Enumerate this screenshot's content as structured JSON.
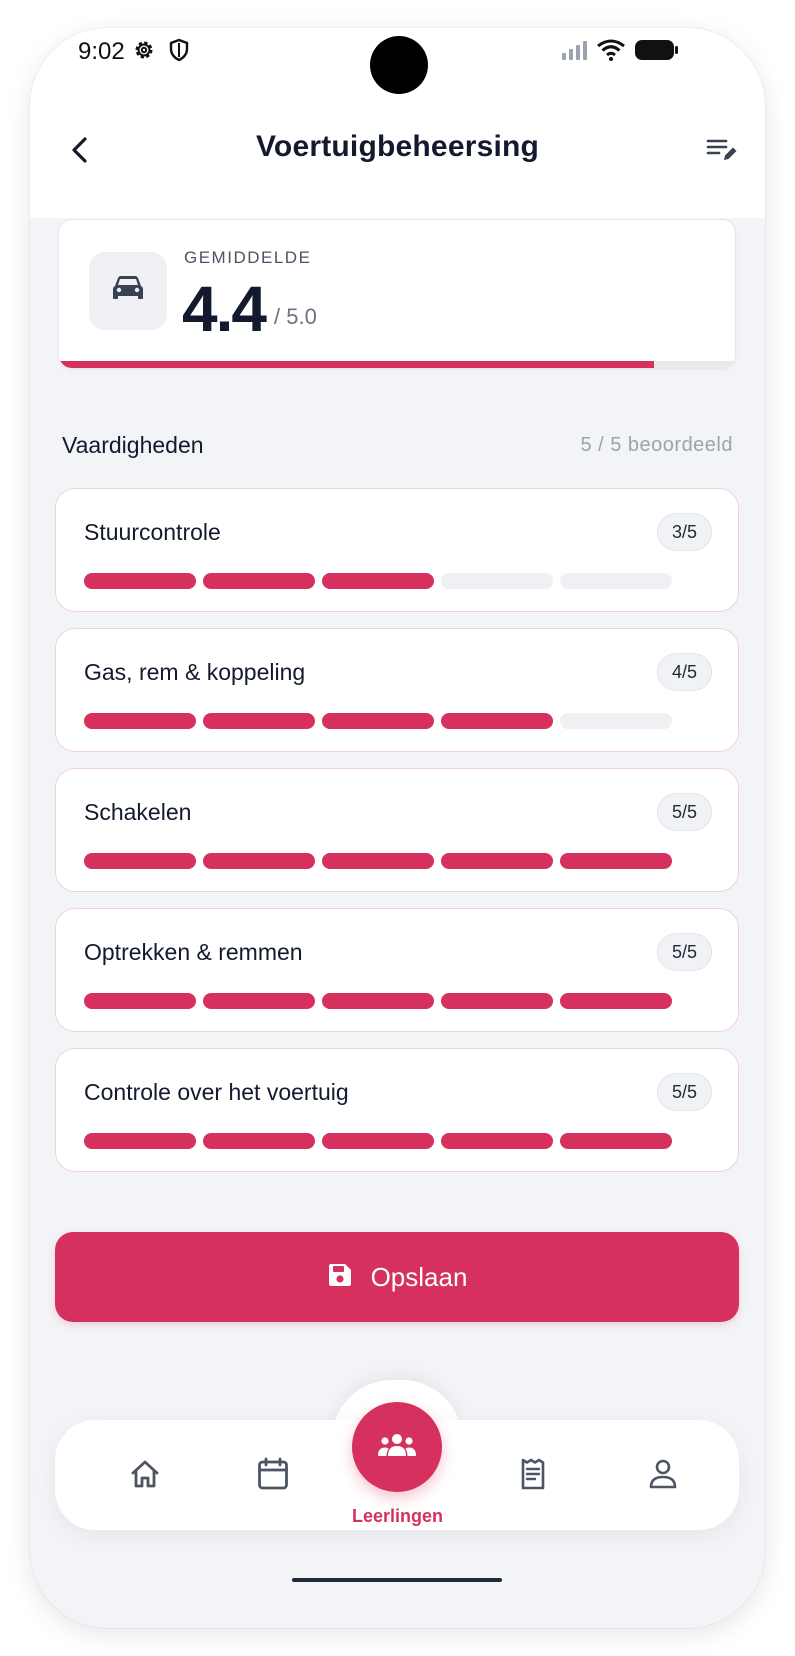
{
  "status_bar": {
    "time": "9:02"
  },
  "header": {
    "title": "Voertuigbeheersing"
  },
  "average": {
    "label": "GEMIDDELDE",
    "value": "4.4",
    "max": "/ 5.0",
    "fraction": 0.88
  },
  "skills_section": {
    "title": "Vaardigheden",
    "count": "5 / 5 beoordeeld"
  },
  "skills": [
    {
      "name": "Stuurcontrole",
      "score_label": "3/5",
      "score": 3,
      "max": 5
    },
    {
      "name": "Gas, rem & koppeling",
      "score_label": "4/5",
      "score": 4,
      "max": 5
    },
    {
      "name": "Schakelen",
      "score_label": "5/5",
      "score": 5,
      "max": 5
    },
    {
      "name": "Optrekken & remmen",
      "score_label": "5/5",
      "score": 5,
      "max": 5
    },
    {
      "name": "Controle over het voertuig",
      "score_label": "5/5",
      "score": 5,
      "max": 5
    }
  ],
  "save_button": {
    "label": "Opslaan"
  },
  "bottom_nav": {
    "active": "students",
    "items": [
      {
        "id": "home",
        "icon": "home-icon"
      },
      {
        "id": "calendar",
        "icon": "calendar-icon"
      },
      {
        "id": "students",
        "icon": "users-icon",
        "label": "Leerlingen"
      },
      {
        "id": "receipts",
        "icon": "receipt-icon"
      },
      {
        "id": "profile",
        "icon": "user-icon"
      }
    ]
  },
  "colors": {
    "accent": "#d6305e",
    "text": "#141a2e",
    "muted": "#9ca3af",
    "background": "#f3f4f7"
  }
}
